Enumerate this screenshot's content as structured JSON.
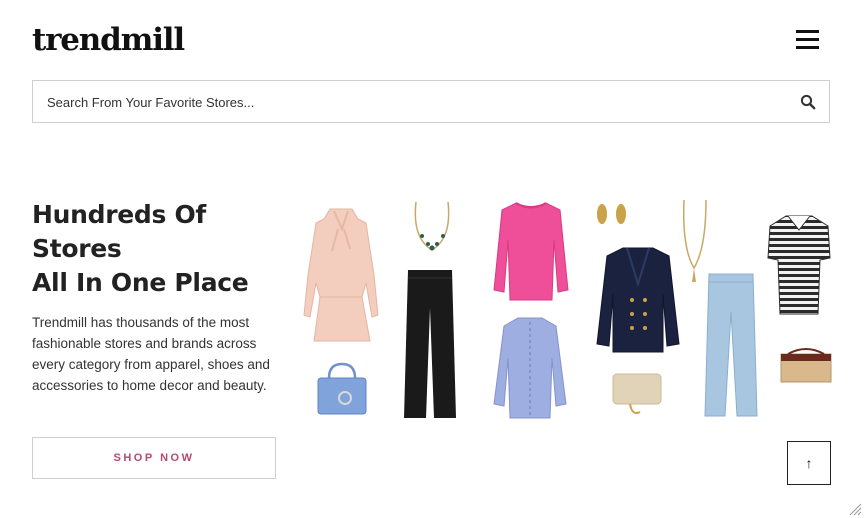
{
  "header": {
    "logo": "trendmill",
    "menu_icon": "hamburger-icon"
  },
  "search": {
    "placeholder": "Search From Your Favorite Stores...",
    "value": "",
    "icon": "search-icon"
  },
  "hero": {
    "title_lines": [
      "Hundreds Of",
      "Stores",
      "All In One Place"
    ],
    "description": "Trendmill has thousands of the most fashionable stores and brands across every category from apparel, shoes and accessories to home decor and beauty.",
    "cta_label": "SHOP NOW",
    "cta_color": "#b54a6c"
  },
  "products": [
    {
      "item": "blush pink bow-neck dress",
      "color": "#f3cdbd"
    },
    {
      "item": "blue leather handbag",
      "color": "#7fa3da"
    },
    {
      "item": "gold gemstone necklace",
      "color": "#c9a867"
    },
    {
      "item": "black wide-leg trousers",
      "color": "#1a1a1a"
    },
    {
      "item": "pink knit sweater",
      "color": "#ef4f99"
    },
    {
      "item": "blue striped ruffle blouse",
      "color": "#9eaee0"
    },
    {
      "item": "gold drop earrings",
      "color": "#c9a24a"
    },
    {
      "item": "navy double-breasted blazer",
      "color": "#1b2240"
    },
    {
      "item": "beige crossbody bag",
      "color": "#e0d3b8"
    },
    {
      "item": "gold pendant necklace",
      "color": "#c9a867"
    },
    {
      "item": "light-wash jeans",
      "color": "#a8c6e0"
    },
    {
      "item": "striped polo shirt",
      "color": "#2b2b2b"
    },
    {
      "item": "straw basket bag",
      "color": "#d9b98c"
    }
  ],
  "scroll_top": {
    "label": "↑",
    "icon": "arrow-up-icon"
  }
}
